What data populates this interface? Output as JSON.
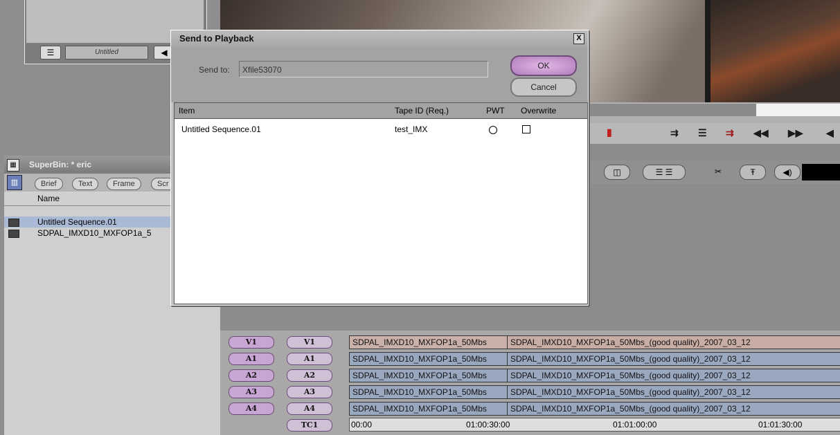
{
  "top_panel": {
    "untitled_label": "Untitled"
  },
  "superbin": {
    "title": "SuperBin: * eric",
    "tabs": [
      "Brief",
      "Text",
      "Frame",
      "Scr"
    ],
    "column_header": "Name",
    "items": [
      {
        "name": "Untitled Sequence.01",
        "selected": true
      },
      {
        "name": "SDPAL_IMXD10_MXFOP1a_5"
      }
    ]
  },
  "dialog": {
    "title": "Send to Playback",
    "close_glyph": "X",
    "send_to_label": "Send to:",
    "send_to_value": "Xfile53070",
    "ok_label": "OK",
    "cancel_label": "Cancel",
    "columns": {
      "item": "Item",
      "tape_id": "Tape ID (Req.)",
      "pwt": "PWT",
      "overwrite": "Overwrite"
    },
    "rows": [
      {
        "item": "Untitled Sequence.01",
        "tape_id": "test_IMX",
        "pwt": "circle",
        "overwrite": "checkbox"
      }
    ]
  },
  "timeline": {
    "tracks": [
      {
        "src": "V1",
        "rec": "V1",
        "clip_a": "SDPAL_IMXD10_MXFOP1a_50Mbs",
        "clip_b": "SDPAL_IMXD10_MXFOP1a_50Mbs_(good quality)_2007_03_12"
      },
      {
        "src": "A1",
        "rec": "A1",
        "clip_a": "SDPAL_IMXD10_MXFOP1a_50Mbs",
        "clip_b": "SDPAL_IMXD10_MXFOP1a_50Mbs_(good quality)_2007_03_12"
      },
      {
        "src": "A2",
        "rec": "A2",
        "clip_a": "SDPAL_IMXD10_MXFOP1a_50Mbs",
        "clip_b": "SDPAL_IMXD10_MXFOP1a_50Mbs_(good quality)_2007_03_12"
      },
      {
        "src": "A3",
        "rec": "A3",
        "clip_a": "SDPAL_IMXD10_MXFOP1a_50Mbs",
        "clip_b": "SDPAL_IMXD10_MXFOP1a_50Mbs_(good quality)_2007_03_12"
      },
      {
        "src": "A4",
        "rec": "A4",
        "clip_a": "SDPAL_IMXD10_MXFOP1a_50Mbs",
        "clip_b": "SDPAL_IMXD10_MXFOP1a_50Mbs_(good quality)_2007_03_12"
      }
    ],
    "tc_label": "TC1",
    "timecodes": [
      "00:00",
      "01:00:30:00",
      "01:01:00:00",
      "01:01:30:00"
    ]
  }
}
